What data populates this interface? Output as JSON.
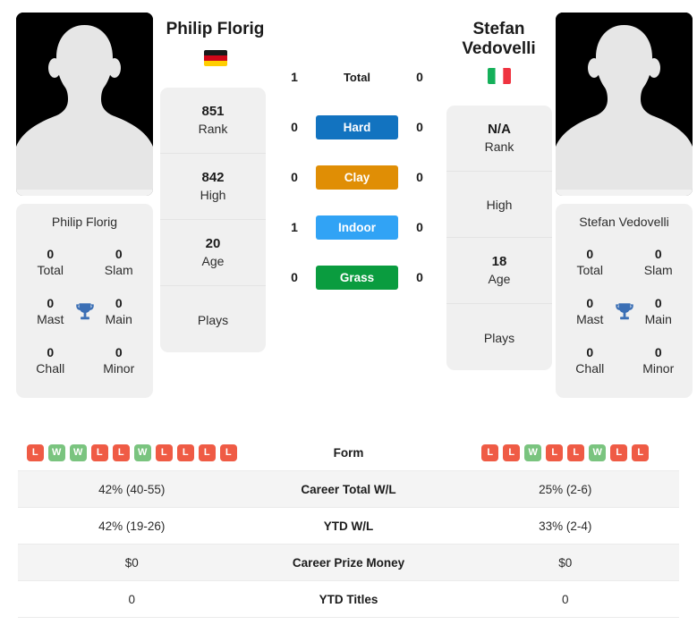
{
  "players": {
    "left": {
      "name": "Philip Florig",
      "name_lines": [
        "Philip Florig"
      ],
      "country": "Germany",
      "flag": "flag-germany",
      "rank": "851",
      "rank_label": "Rank",
      "high": "842",
      "high_label": "High",
      "age": "20",
      "age_label": "Age",
      "plays": "",
      "plays_label": "Plays",
      "titles": {
        "heading": "Philip Florig",
        "total": "0",
        "total_label": "Total",
        "slam": "0",
        "slam_label": "Slam",
        "mast": "0",
        "mast_label": "Mast",
        "main": "0",
        "main_label": "Main",
        "chall": "0",
        "chall_label": "Chall",
        "minor": "0",
        "minor_label": "Minor"
      },
      "form": [
        "L",
        "W",
        "W",
        "L",
        "L",
        "W",
        "L",
        "L",
        "L",
        "L"
      ],
      "career_total_wl": "42% (40-55)",
      "ytd_wl": "42% (19-26)",
      "career_prize_money": "$0",
      "ytd_titles": "0"
    },
    "right": {
      "name": "Stefan Vedovelli",
      "name_lines": [
        "Stefan",
        "Vedovelli"
      ],
      "country": "Italy",
      "flag": "flag-italy",
      "rank": "N/A",
      "rank_label": "Rank",
      "high": "",
      "high_label": "High",
      "age": "18",
      "age_label": "Age",
      "plays": "",
      "plays_label": "Plays",
      "titles": {
        "heading": "Stefan Vedovelli",
        "total": "0",
        "total_label": "Total",
        "slam": "0",
        "slam_label": "Slam",
        "mast": "0",
        "mast_label": "Mast",
        "main": "0",
        "main_label": "Main",
        "chall": "0",
        "chall_label": "Chall",
        "minor": "0",
        "minor_label": "Minor"
      },
      "form": [
        "L",
        "L",
        "W",
        "L",
        "L",
        "W",
        "L",
        "L"
      ],
      "career_total_wl": "25% (2-6)",
      "ytd_wl": "33% (2-4)",
      "career_prize_money": "$0",
      "ytd_titles": "0"
    }
  },
  "h2h": [
    {
      "key": "total",
      "label": "Total",
      "left": "1",
      "right": "0",
      "style": "plain",
      "color": ""
    },
    {
      "key": "hard",
      "label": "Hard",
      "left": "0",
      "right": "0",
      "style": "badge",
      "color": "#1273c0"
    },
    {
      "key": "clay",
      "label": "Clay",
      "left": "0",
      "right": "0",
      "style": "badge",
      "color": "#e08e05"
    },
    {
      "key": "indoor",
      "label": "Indoor",
      "left": "1",
      "right": "0",
      "style": "badge",
      "color": "#31a3f5"
    },
    {
      "key": "grass",
      "label": "Grass",
      "left": "0",
      "right": "0",
      "style": "badge",
      "color": "#0a9c3f"
    }
  ],
  "stats_rows": [
    {
      "key": "form",
      "label": "Form"
    },
    {
      "key": "career_total_wl",
      "label": "Career Total W/L"
    },
    {
      "key": "ytd_wl",
      "label": "YTD W/L"
    },
    {
      "key": "career_prize_money",
      "label": "Career Prize Money"
    },
    {
      "key": "ytd_titles",
      "label": "YTD Titles"
    }
  ],
  "colors": {
    "win_badge": "#7ac47f",
    "loss_badge": "#ef5b45",
    "card_bg": "#f0f0f0",
    "row_alt_bg": "#f4f4f4",
    "avatar_bg": "#000000"
  }
}
